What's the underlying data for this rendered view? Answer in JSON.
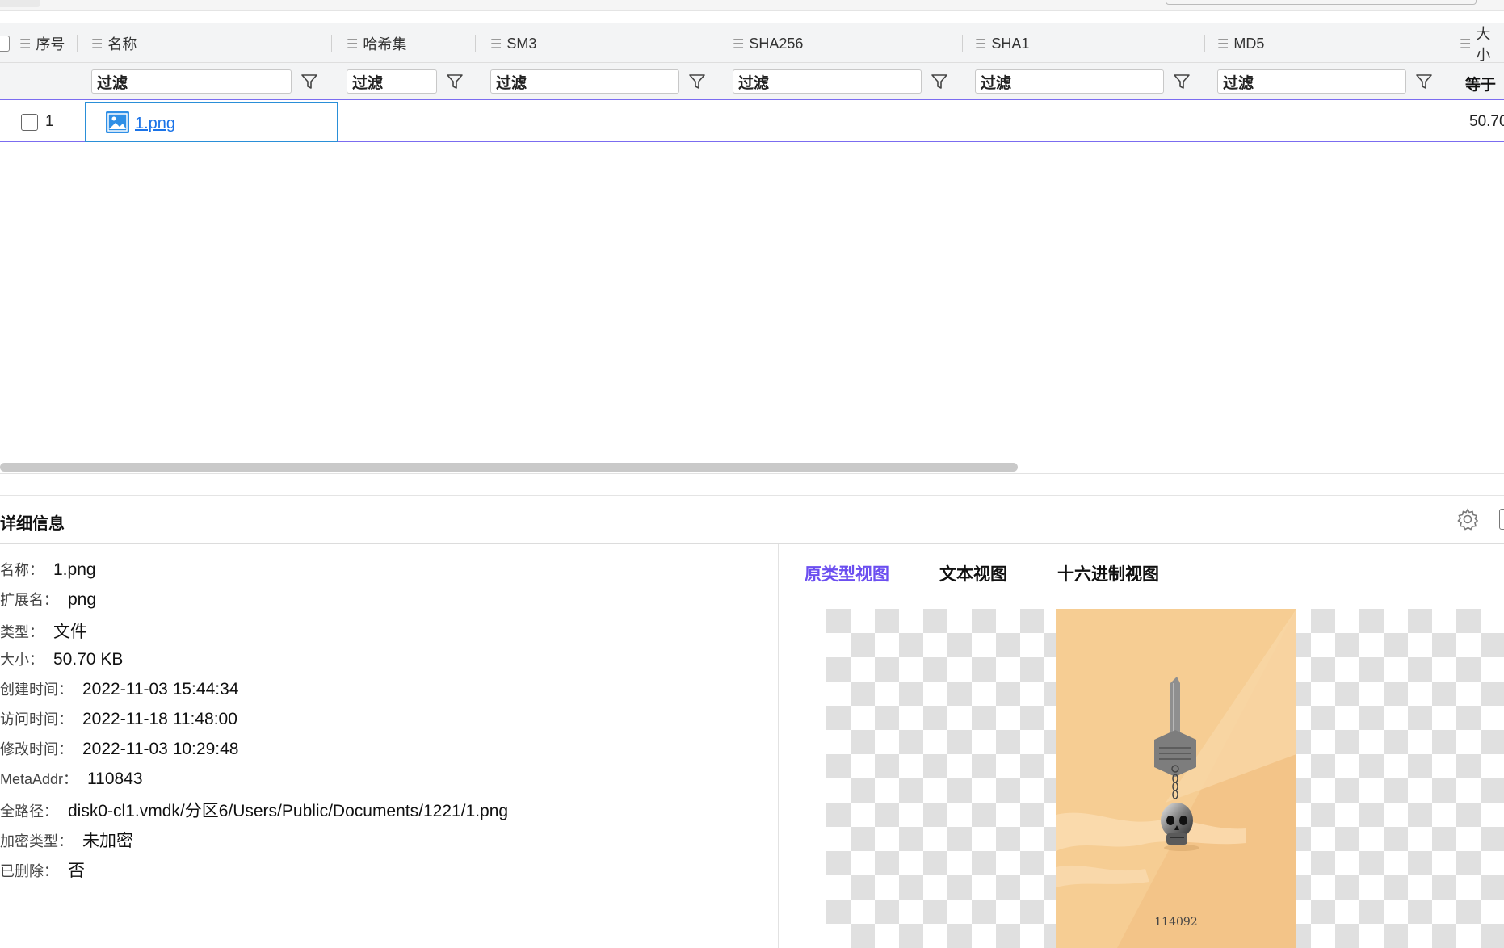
{
  "table": {
    "columns": {
      "index": "序号",
      "name": "名称",
      "hashset": "哈希集",
      "sm3": "SM3",
      "sha256": "SHA256",
      "sha1": "SHA1",
      "md5": "MD5",
      "size": "大小"
    },
    "filter_placeholder": "过滤",
    "size_filter_op": "等于",
    "rows": [
      {
        "index": "1",
        "name": "1.png",
        "size": "50.70"
      }
    ]
  },
  "details": {
    "title": "详细信息",
    "fields": [
      {
        "key": "名称：",
        "value": "1.png"
      },
      {
        "key": "扩展名：",
        "value": "png"
      },
      {
        "key": "类型：",
        "value": "文件"
      },
      {
        "key": "大小：",
        "value": "50.70 KB"
      },
      {
        "key": "创建时间：",
        "value": "2022-11-03 15:44:34"
      },
      {
        "key": "访问时间：",
        "value": "2022-11-18 11:48:00"
      },
      {
        "key": "修改时间：",
        "value": "2022-11-03 10:29:48"
      },
      {
        "key": "MetaAddr：",
        "value": "110843"
      },
      {
        "key": "全路径：",
        "value": "disk0-cl1.vmdk/分区6/Users/Public/Documents/1221/1.png"
      },
      {
        "key": "加密类型：",
        "value": "未加密"
      },
      {
        "key": "已删除：",
        "value": "否"
      }
    ],
    "view_tabs": [
      "原类型视图",
      "文本视图",
      "十六进制视图"
    ],
    "active_tab_index": 0,
    "active_tab_color": "#6b4ef0",
    "preview_caption": "114092"
  },
  "colors": {
    "selection_border": "#7b6cf0",
    "cell_focus_border": "#2a8fd8",
    "link": "#1a73e8"
  }
}
